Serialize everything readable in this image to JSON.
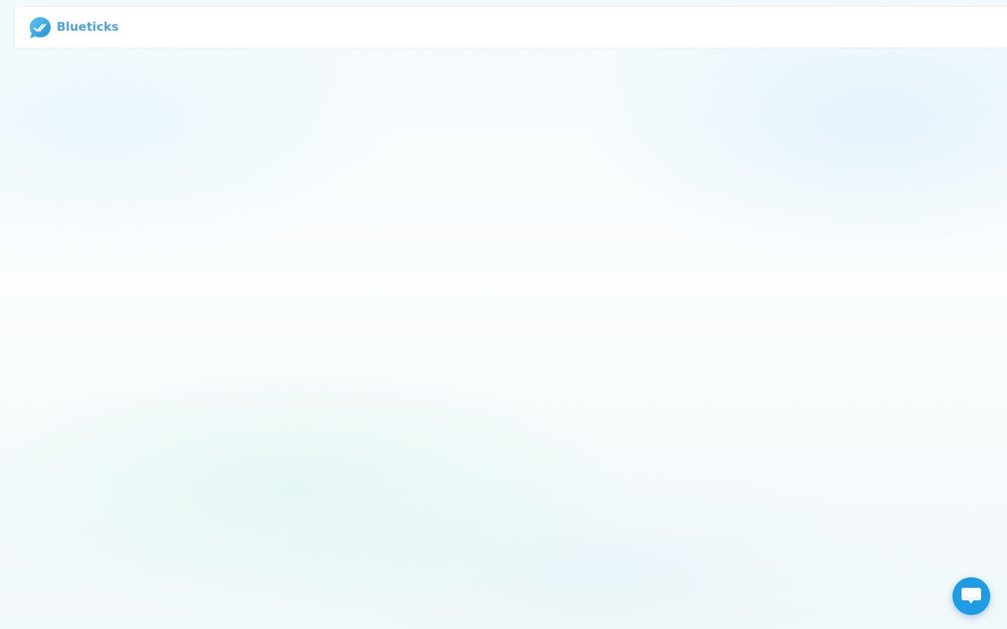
{
  "app": {
    "brand_name": "Blueticks",
    "logo_icon": "double-check-chat-bubble-icon",
    "brand_color": "#4aa3d6"
  },
  "chat_launcher": {
    "icon": "chat-bubble-icon",
    "color": "#1e9ce6"
  }
}
